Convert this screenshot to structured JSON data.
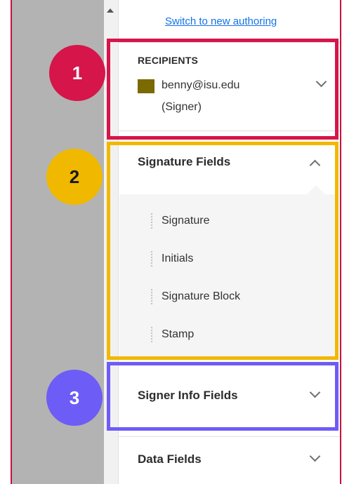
{
  "header": {
    "switch_link": "Switch to new authoring"
  },
  "recipients": {
    "title": "RECIPIENTS",
    "email": "benny@isu.edu",
    "role": "(Signer)",
    "color": "#7a6a00"
  },
  "signature_fields": {
    "title": "Signature Fields",
    "expanded": true,
    "items": [
      "Signature",
      "Initials",
      "Signature Block",
      "Stamp"
    ]
  },
  "signer_info_fields": {
    "title": "Signer Info Fields",
    "expanded": false
  },
  "data_fields": {
    "title": "Data Fields",
    "expanded": false
  },
  "annotations": {
    "badges": [
      "1",
      "2",
      "3"
    ],
    "colors": {
      "badge_1": "#d6154a",
      "badge_2": "#f1b800",
      "badge_3": "#6d5cf6"
    }
  },
  "icons": [
    "scroll-up-icon",
    "chevron-down-icon",
    "chevron-up-icon",
    "drag-handle-icon"
  ]
}
